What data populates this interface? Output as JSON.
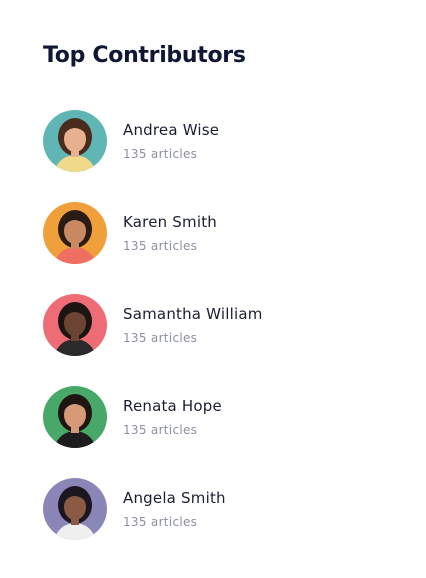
{
  "widget": {
    "title": "Top Contributors"
  },
  "contributors": [
    {
      "name": "Andrea Wise",
      "articles": "135 articles",
      "bg": "#5fb6b5",
      "skin": "#e7b08f",
      "hair": "#4a2c1e",
      "shirt": "#f1d98a"
    },
    {
      "name": "Karen Smith",
      "articles": "135 articles",
      "bg": "#f0a03a",
      "skin": "#c98a63",
      "hair": "#2a1b14",
      "shirt": "#f06f63"
    },
    {
      "name": "Samantha William",
      "articles": "135 articles",
      "bg": "#ee6c76",
      "skin": "#6b4433",
      "hair": "#1c1410",
      "shirt": "#2a2a2a"
    },
    {
      "name": "Renata Hope",
      "articles": "135 articles",
      "bg": "#47a86a",
      "skin": "#d79a78",
      "hair": "#1f1512",
      "shirt": "#1d1d1d"
    },
    {
      "name": "Angela Smith",
      "articles": "135 articles",
      "bg": "#8b86b8",
      "skin": "#8a5a45",
      "hair": "#1c1620",
      "shirt": "#efefef"
    }
  ]
}
